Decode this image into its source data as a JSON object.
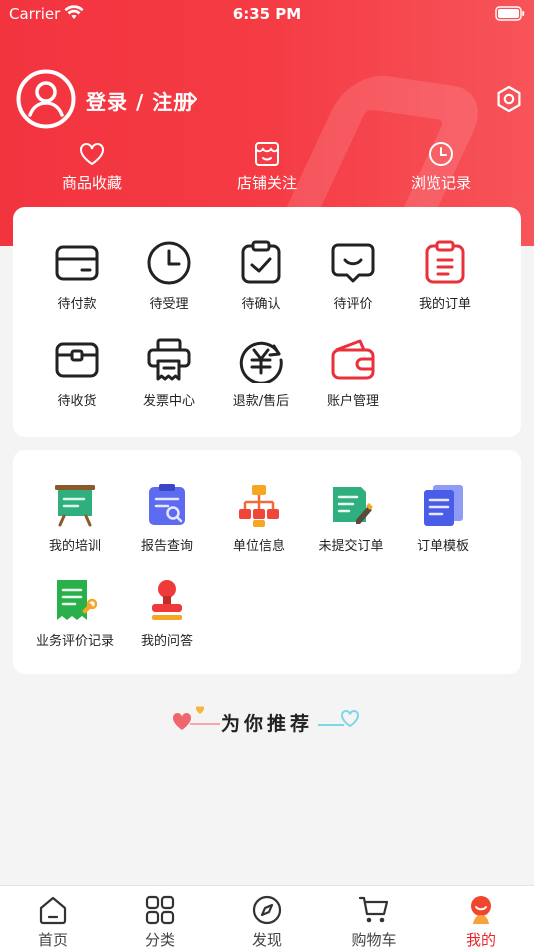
{
  "status_bar": {
    "carrier": "Carrier",
    "time": "6:35 PM"
  },
  "profile": {
    "login_label": "登录 / 注册"
  },
  "quick_links": [
    {
      "label": "商品收藏",
      "icon": "heart-icon"
    },
    {
      "label": "店铺关注",
      "icon": "store-icon"
    },
    {
      "label": "浏览记录",
      "icon": "clock-icon"
    }
  ],
  "orders": [
    {
      "label": "待付款",
      "icon": "wallet-icon"
    },
    {
      "label": "待受理",
      "icon": "clock-icon"
    },
    {
      "label": "待确认",
      "icon": "clipboard-check-icon"
    },
    {
      "label": "待评价",
      "icon": "chat-smile-icon"
    },
    {
      "label": "我的订单",
      "icon": "order-list-icon"
    },
    {
      "label": "待收货",
      "icon": "box-icon"
    },
    {
      "label": "发票中心",
      "icon": "printer-icon"
    },
    {
      "label": "退款/售后",
      "icon": "yen-refresh-icon"
    },
    {
      "label": "账户管理",
      "icon": "wallet-red-icon"
    }
  ],
  "services": [
    {
      "label": "我的培训",
      "icon": "whiteboard-icon"
    },
    {
      "label": "报告查询",
      "icon": "report-search-icon"
    },
    {
      "label": "单位信息",
      "icon": "org-chart-icon"
    },
    {
      "label": "未提交订单",
      "icon": "doc-edit-icon"
    },
    {
      "label": "订单模板",
      "icon": "doc-stack-icon"
    },
    {
      "label": "业务评价记录",
      "icon": "review-doc-icon"
    },
    {
      "label": "我的问答",
      "icon": "stamp-icon"
    }
  ],
  "recommend": {
    "title": "为你推荐"
  },
  "tabs": [
    {
      "label": "首页",
      "icon": "home-icon"
    },
    {
      "label": "分类",
      "icon": "grid-icon"
    },
    {
      "label": "发现",
      "icon": "compass-icon"
    },
    {
      "label": "购物车",
      "icon": "cart-icon"
    },
    {
      "label": "我的",
      "icon": "profile-icon",
      "active": true
    }
  ],
  "colors": {
    "brand_red": "#f2343f",
    "active_tab": "#e8262e"
  }
}
